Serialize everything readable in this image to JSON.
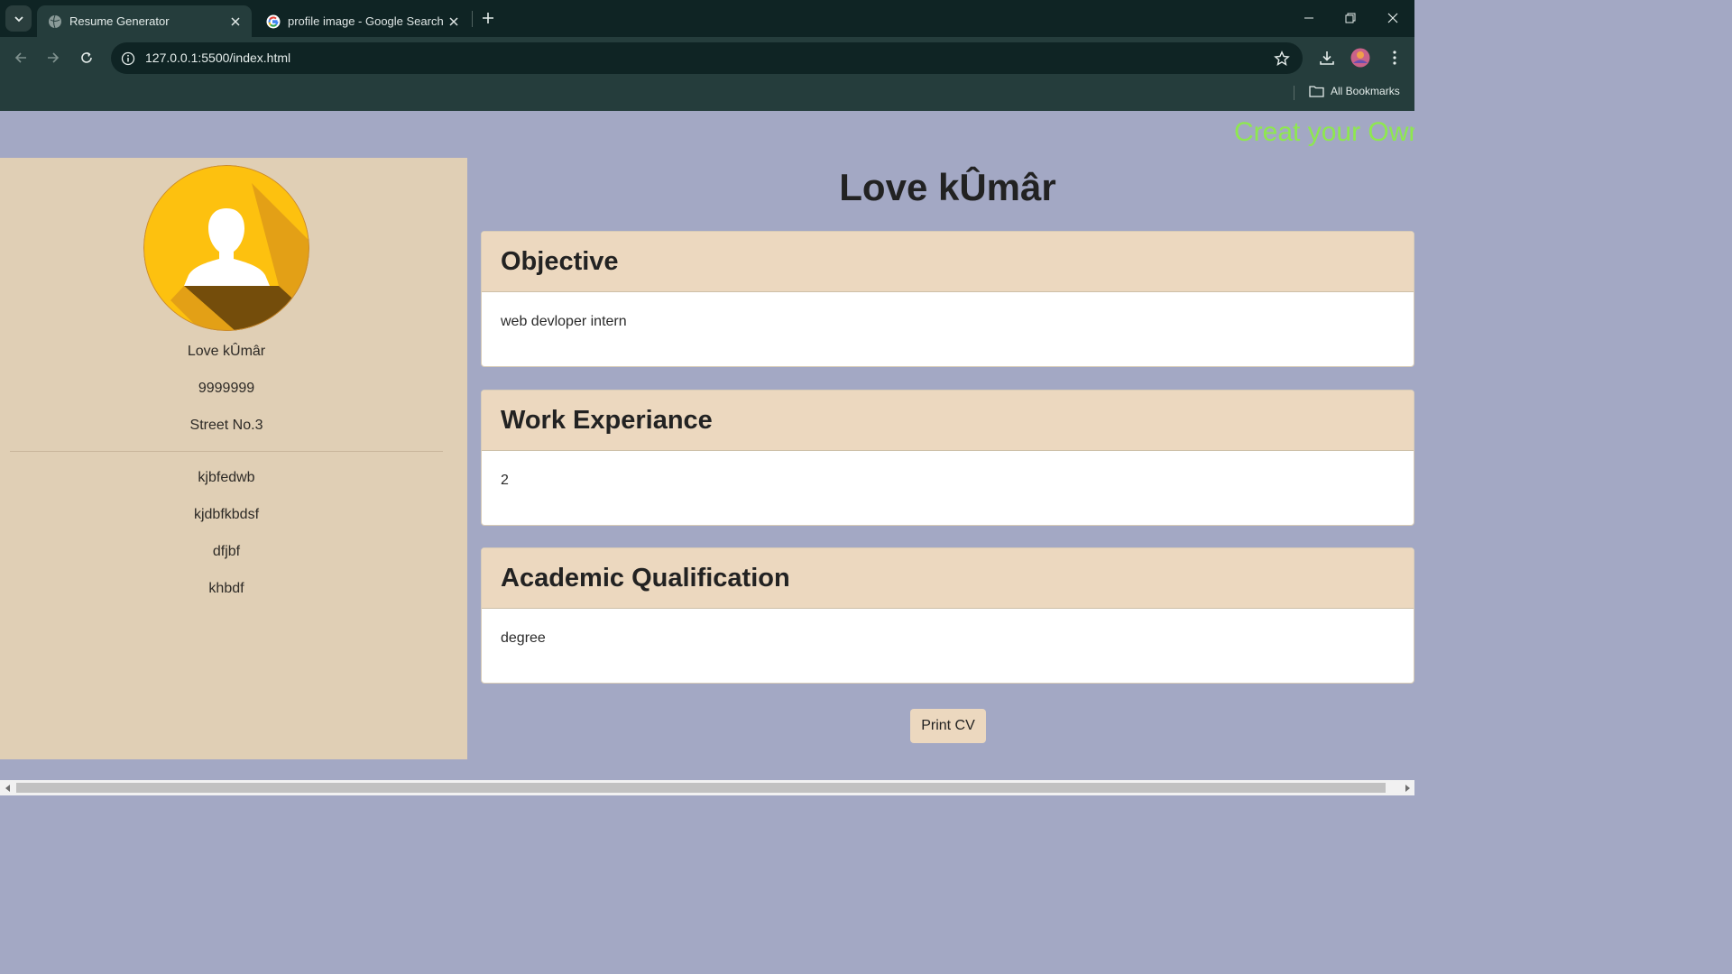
{
  "browser": {
    "tabs": [
      {
        "title": "Resume Generator",
        "active": true
      },
      {
        "title": "profile image - Google Search",
        "active": false
      }
    ],
    "url": "127.0.0.1:5500/index.html",
    "bookmarks_label": "All Bookmarks"
  },
  "page": {
    "marquee_text": "Creat your Own",
    "main_title": "Love kÛmâr",
    "sidebar": {
      "name": "Love kÛmâr",
      "phone": "9999999",
      "address": "Street No.3",
      "links": [
        "kjbfedwb",
        "kjdbfkbdsf",
        "dfjbf",
        "khbdf"
      ]
    },
    "sections": [
      {
        "heading": "Objective",
        "body": "web devloper intern"
      },
      {
        "heading": "Work Experiance",
        "body": "2"
      },
      {
        "heading": "Academic Qualification",
        "body": "degree"
      }
    ],
    "print_button": "Print CV"
  },
  "colors": {
    "page_bg": "#a3a8c4",
    "sidebar_bg": "#e0cfb5",
    "card_header_bg": "#ecd8bf",
    "marquee_text": "#8ee84f",
    "chrome_dark": "#0f2424",
    "chrome_toolbar": "#253d3c"
  }
}
